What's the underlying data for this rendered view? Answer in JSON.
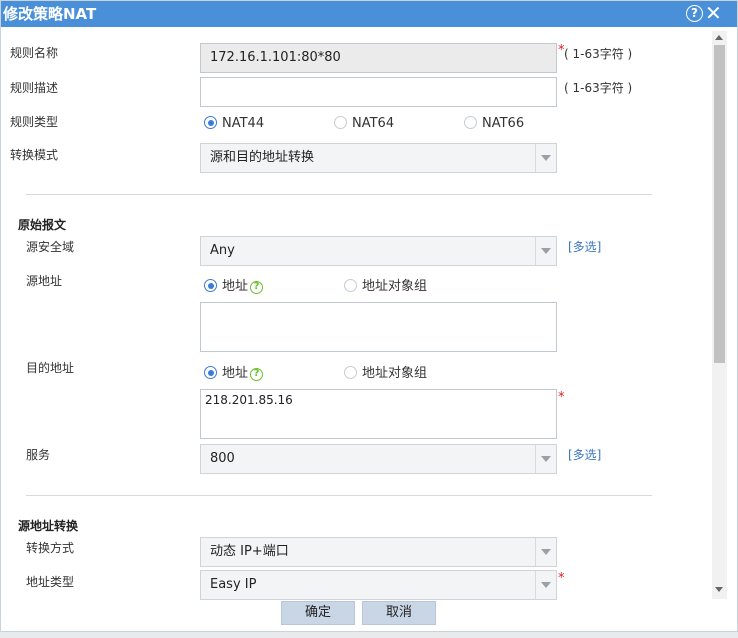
{
  "dialog": {
    "title": "修改策略NAT",
    "help_glyph": "?",
    "close_glyph": "✕"
  },
  "rule": {
    "name_label": "规则名称",
    "name_value": "172.16.1.101:80*80",
    "name_hint": "( 1-63字符 )",
    "desc_label": "规则描述",
    "desc_value": "",
    "desc_hint": "( 1-63字符 )",
    "type_label": "规则类型",
    "type_options": [
      "NAT44",
      "NAT64",
      "NAT66"
    ],
    "type_selected": "NAT44",
    "mode_label": "转换模式",
    "mode_value": "源和目的地址转换"
  },
  "original_packet": {
    "title": "原始报文",
    "src_zone_label": "源安全域",
    "src_zone_value": "Any",
    "multi_select_link": "[多选]",
    "src_addr_label": "源地址",
    "addr_option": "地址",
    "addr_group_option": "地址对象组",
    "src_addr_value": "",
    "dst_addr_label": "目的地址",
    "dst_addr_value": "218.201.85.16",
    "service_label": "服务",
    "service_value": "800"
  },
  "src_nat": {
    "title": "源地址转换",
    "method_label": "转换方式",
    "method_value": "动态 IP+端口",
    "addr_type_label": "地址类型",
    "addr_type_value": "Easy IP"
  },
  "footer": {
    "ok_label": "确定",
    "cancel_label": "取消"
  },
  "required_mark": "*",
  "colors": {
    "titlebar": "#4a90d9",
    "radio_accent": "#3a7bd5",
    "link": "#3a74c4",
    "required": "#e02020",
    "button": "#c9d6e6"
  }
}
